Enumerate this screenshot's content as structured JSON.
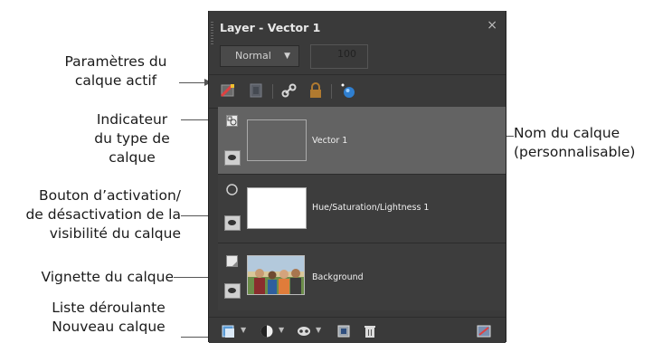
{
  "panel": {
    "title": "Layer - Vector 1",
    "close_symbol": "×",
    "blend_mode": "Normal",
    "opacity": "100",
    "toolbar_icons": [
      "layer-properties-icon",
      "layer-mask-icon",
      "link-icon",
      "lock-icon",
      "refine-icon"
    ],
    "layers": [
      {
        "name": "Vector 1",
        "type_icon": "vector-layer-icon",
        "selected": true
      },
      {
        "name": "Hue/Saturation/Lightness 1",
        "type_icon": "adjustment-layer-icon",
        "selected": false
      },
      {
        "name": "Background",
        "type_icon": "raster-layer-icon",
        "selected": false
      }
    ],
    "bottom_icons": [
      "new-layer-icon",
      "new-adjustment-icon",
      "new-mask-icon",
      "promote-icon",
      "delete-icon",
      "properties-icon"
    ]
  },
  "annotations": {
    "active_params": "Paramètres du\ncalque actif",
    "type_indicator": "Indicateur\ndu type de\ncalque",
    "visibility": "Bouton d’activation/\nde désactivation de la\nvisibilité du calque",
    "thumbnail": "Vignette du calque",
    "new_layer": "Liste déroulante\nNouveau calque",
    "layer_name": "Nom du calque\n(personnalisable)"
  },
  "colors": {
    "panel_bg": "#3a3a3a",
    "selected_row": "#636363",
    "annotation_line": "#555555"
  }
}
